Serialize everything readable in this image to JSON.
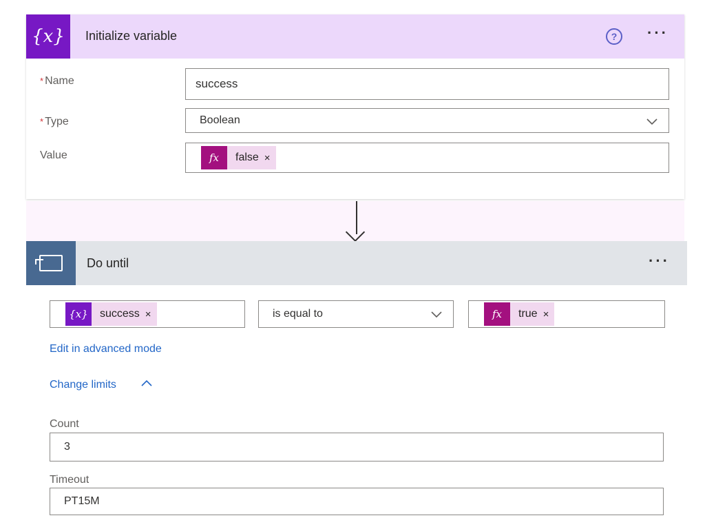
{
  "init_variable": {
    "title": "Initialize variable",
    "icon_glyph": "{x}",
    "help_glyph": "?",
    "more_glyph": "···",
    "required_marker": "*",
    "name_label": "Name",
    "name_value": "success",
    "type_label": "Type",
    "type_value": "Boolean",
    "value_label": "Value",
    "value_token": {
      "icon": "fx",
      "text": "false",
      "remove": "×"
    }
  },
  "do_until": {
    "title": "Do until",
    "more_glyph": "···",
    "condition": {
      "left_token": {
        "icon": "{x}",
        "text": "success",
        "remove": "×"
      },
      "operator": "is equal to",
      "right_token": {
        "icon": "fx",
        "text": "true",
        "remove": "×"
      }
    },
    "advanced_link": "Edit in advanced mode",
    "limits_link": "Change limits",
    "count_label": "Count",
    "count_value": "3",
    "timeout_label": "Timeout",
    "timeout_value": "PT15M"
  },
  "colors": {
    "variable_header": "#ecd8fb",
    "variable_icon": "#7718c4",
    "expression_icon": "#a3107f",
    "loop_header": "#e1e4e8",
    "loop_icon": "#486991",
    "link": "#2266c7"
  },
  "icons": {
    "variable": "variable-icon",
    "help": "help-circle-icon",
    "more": "more-options-icon",
    "chevron": "chevron-down-icon",
    "expression": "fx-icon",
    "loop": "do-until-loop-icon",
    "arrow": "arrow-down-icon"
  }
}
